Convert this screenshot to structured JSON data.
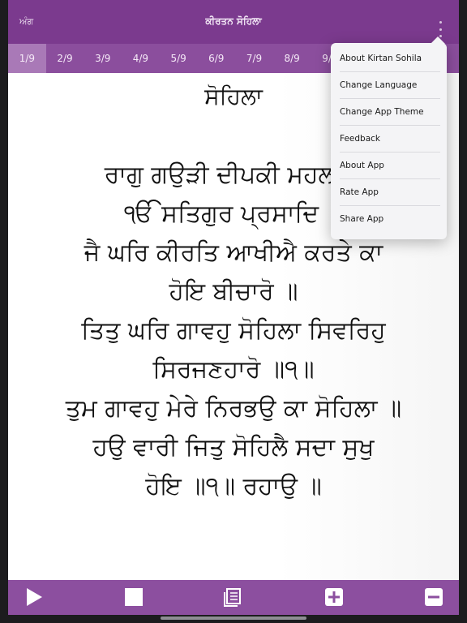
{
  "header": {
    "left_label": "ਅੰਗ",
    "title": "ਕੀਰਤਨ ਸੋਹਿਲਾ"
  },
  "tabs": [
    {
      "label": "1/9",
      "active": true
    },
    {
      "label": "2/9"
    },
    {
      "label": "3/9"
    },
    {
      "label": "4/9"
    },
    {
      "label": "5/9"
    },
    {
      "label": "6/9"
    },
    {
      "label": "7/9"
    },
    {
      "label": "8/9"
    },
    {
      "label": "9/9"
    }
  ],
  "content": {
    "heading": "ਸੋਹਿਲਾ",
    "lines": [
      "ਰਾਗੁ ਗਉੜੀ ਦੀਪਕੀ ਮਹਲਾ ੧",
      "ੴ ਸਤਿਗੁਰ ਪ੍ਰਸਾਦਿ ॥",
      "ਜੈ ਘਰਿ ਕੀਰਤਿ ਆਖੀਐ ਕਰਤੇ ਕਾ",
      "ਹੋਇ ਬੀਚਾਰੋ ॥",
      "ਤਿਤੁ ਘਰਿ ਗਾਵਹੁ ਸੋਹਿਲਾ ਸਿਵਰਿਹੁ",
      "ਸਿਰਜਣਹਾਰੋ ॥੧॥",
      "ਤੁਮ ਗਾਵਹੁ ਮੇਰੇ ਨਿਰਭਉ ਕਾ ਸੋਹਿਲਾ ॥",
      "ਹਉ ਵਾਰੀ ਜਿਤੁ ਸੋਹਿਲੈ ਸਦਾ ਸੁਖੁ",
      "ਹੋਇ ॥੧॥ ਰਹਾਉ ॥"
    ]
  },
  "menu": {
    "items": [
      "About Kirtan Sohila",
      "Change Language",
      "Change App Theme",
      "Feedback",
      "About App",
      "Rate App",
      "Share App"
    ]
  },
  "toolbar": {
    "icons": [
      "play-icon",
      "stop-icon",
      "book-icon",
      "plus-icon",
      "minus-icon"
    ]
  },
  "colors": {
    "header": "#7b3a8e",
    "tabs": "#8b4e9d",
    "active_tab": "#a979b7",
    "toolbar": "#8c4f9f"
  }
}
